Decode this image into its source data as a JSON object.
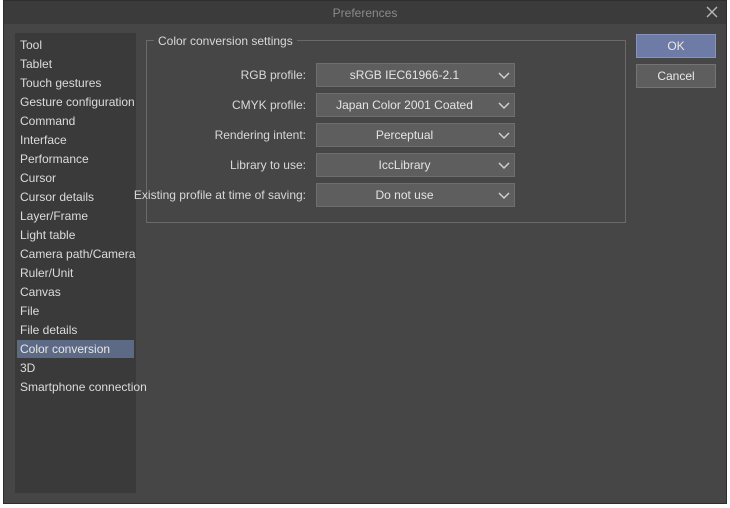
{
  "window": {
    "title": "Preferences"
  },
  "sidebar": {
    "items": [
      {
        "label": "Tool",
        "selected": false
      },
      {
        "label": "Tablet",
        "selected": false
      },
      {
        "label": "Touch gestures",
        "selected": false
      },
      {
        "label": "Gesture configuration",
        "selected": false
      },
      {
        "label": "Command",
        "selected": false
      },
      {
        "label": "Interface",
        "selected": false
      },
      {
        "label": "Performance",
        "selected": false
      },
      {
        "label": "Cursor",
        "selected": false
      },
      {
        "label": "Cursor details",
        "selected": false
      },
      {
        "label": "Layer/Frame",
        "selected": false
      },
      {
        "label": "Light table",
        "selected": false
      },
      {
        "label": "Camera path/Camera",
        "selected": false
      },
      {
        "label": "Ruler/Unit",
        "selected": false
      },
      {
        "label": "Canvas",
        "selected": false
      },
      {
        "label": "File",
        "selected": false
      },
      {
        "label": "File details",
        "selected": false
      },
      {
        "label": "Color conversion",
        "selected": true
      },
      {
        "label": "3D",
        "selected": false
      },
      {
        "label": "Smartphone connection",
        "selected": false
      }
    ]
  },
  "settings": {
    "group_title": "Color conversion settings",
    "rows": [
      {
        "label": "RGB profile:",
        "value": "sRGB IEC61966-2.1"
      },
      {
        "label": "CMYK profile:",
        "value": "Japan Color 2001 Coated"
      },
      {
        "label": "Rendering intent:",
        "value": "Perceptual"
      },
      {
        "label": "Library to use:",
        "value": "IccLibrary"
      },
      {
        "label": "Existing profile at time of saving:",
        "value": "Do not use"
      }
    ]
  },
  "buttons": {
    "ok": "OK",
    "cancel": "Cancel"
  },
  "colors": {
    "selection": "#5d6a85",
    "ok_button": "#6e7ba6",
    "panel": "#464646"
  }
}
